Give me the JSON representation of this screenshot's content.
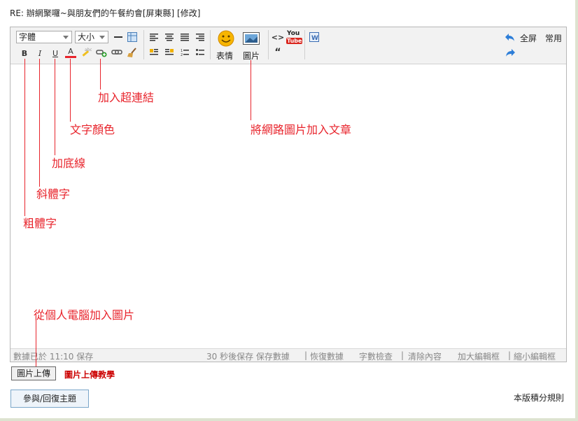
{
  "post_title": "RE: 辦網聚囉~與朋友們的午餐約會[屏東縣] [修改]",
  "toolbar": {
    "font_select": "字體",
    "size_select": "大小",
    "emoticon_label": "表情",
    "image_label": "圖片",
    "fullscreen_label": "全屏",
    "common_label": "常用",
    "youtube_top": "You",
    "youtube_bottom": "Tube",
    "bold": "B",
    "italic": "I",
    "underline": "U",
    "font_color": "A",
    "quote": "“",
    "code": "<>"
  },
  "status_bar": {
    "saved_at": "數據已於  11:10 保存",
    "autosave": "30 秒後保存 保存數據",
    "restore": "恢復數據",
    "word_count": "字數檢查",
    "clear": "清除內容",
    "enlarge": "加大編輯框",
    "shrink": "縮小編輯框"
  },
  "annotations": {
    "hyperlink": "加入超連結",
    "text_color": "文字顏色",
    "underline": "加底線",
    "italic": "斜體字",
    "bold": "粗體字",
    "web_image": "將網路圖片加入文章",
    "upload_from_pc": "從個人電腦加入圖片"
  },
  "upload_button": "圖片上傳",
  "upload_tutorial": "圖片上傳教學",
  "reply_button": "參與/回復主題",
  "board_rules": "本版積分規則",
  "colors": {
    "annotation_red": "#e8242c",
    "toolbar_bg": "#f2f2f2",
    "border_gray": "#b7b7b7",
    "tutorial_red": "#cc0000"
  }
}
